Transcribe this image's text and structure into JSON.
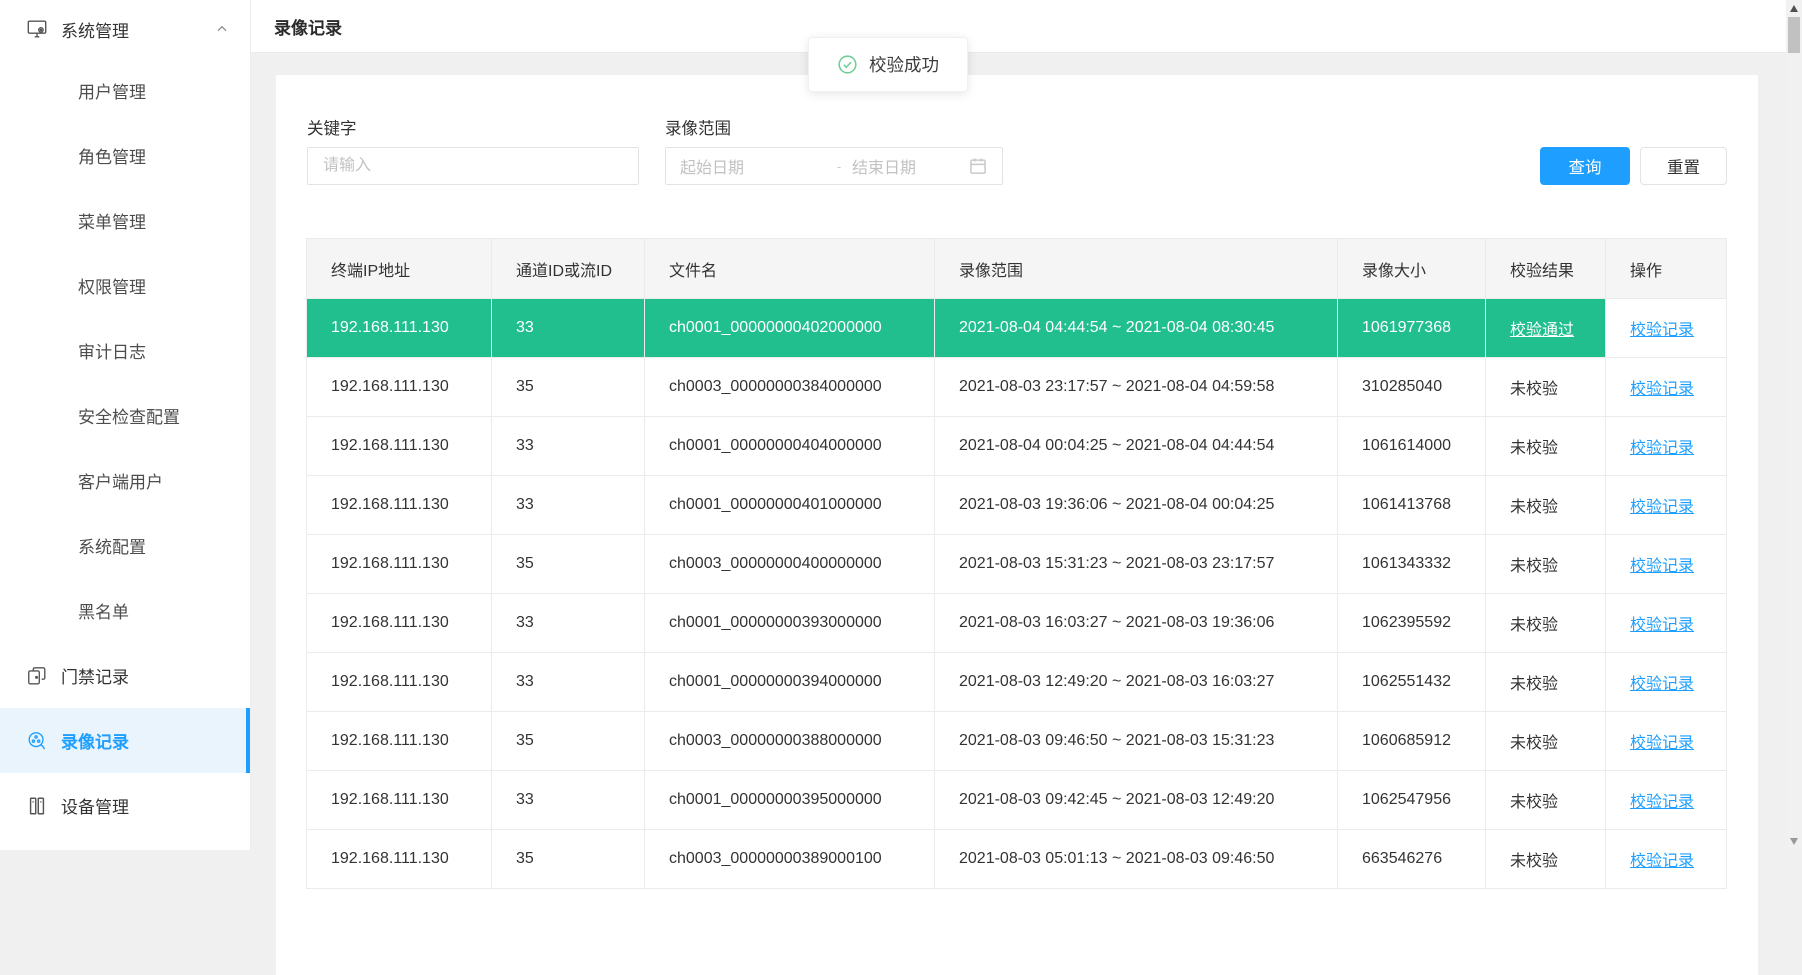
{
  "colors": {
    "accent_blue": "#1e9fff",
    "selected_green": "#21be8e",
    "toast_green": "#6fce97",
    "header_gray": "#f5f5f5"
  },
  "topbar": {
    "title": "录像记录"
  },
  "toast": {
    "text": "校验成功",
    "icon": "success-check-icon"
  },
  "sidebar": {
    "items": [
      {
        "type": "group",
        "name": "system-management",
        "label": "系统管理",
        "icon": "monitor-gear-icon",
        "state": "expanded"
      },
      {
        "type": "sub",
        "name": "user-management",
        "label": "用户管理"
      },
      {
        "type": "sub",
        "name": "role-management",
        "label": "角色管理"
      },
      {
        "type": "sub",
        "name": "menu-management",
        "label": "菜单管理"
      },
      {
        "type": "sub",
        "name": "permission-management",
        "label": "权限管理"
      },
      {
        "type": "sub",
        "name": "audit-log",
        "label": "审计日志"
      },
      {
        "type": "sub",
        "name": "security-check-config",
        "label": "安全检查配置"
      },
      {
        "type": "sub",
        "name": "client-user",
        "label": "客户端用户"
      },
      {
        "type": "sub",
        "name": "system-config",
        "label": "系统配置"
      },
      {
        "type": "sub",
        "name": "blacklist",
        "label": "黑名单"
      },
      {
        "type": "top",
        "name": "access-records",
        "label": "门禁记录",
        "icon": "door-access-icon"
      },
      {
        "type": "top",
        "name": "video-records",
        "label": "录像记录",
        "icon": "film-reel-icon",
        "active": true
      },
      {
        "type": "top",
        "name": "device-management",
        "label": "设备管理",
        "icon": "device-rack-icon"
      }
    ]
  },
  "filters": {
    "keyword_label": "关键字",
    "keyword_placeholder": "请输入",
    "range_label": "录像范围",
    "range_start_placeholder": "起始日期",
    "range_separator": "-",
    "range_end_placeholder": "结束日期",
    "search_label": "查询",
    "reset_label": "重置"
  },
  "table": {
    "columns": [
      "终端IP地址",
      "通道ID或流ID",
      "文件名",
      "录像范围",
      "录像大小",
      "校验结果",
      "操作"
    ],
    "action_label": "校验记录",
    "rows": [
      {
        "ip": "192.168.111.130",
        "channel": "33",
        "file": "ch0001_00000000402000000",
        "range": "2021-08-04 04:44:54 ~ 2021-08-04 08:30:45",
        "size": "1061977368",
        "result": "校验通过",
        "selected": true
      },
      {
        "ip": "192.168.111.130",
        "channel": "35",
        "file": "ch0003_00000000384000000",
        "range": "2021-08-03 23:17:57 ~ 2021-08-04 04:59:58",
        "size": "310285040",
        "result": "未校验",
        "selected": false
      },
      {
        "ip": "192.168.111.130",
        "channel": "33",
        "file": "ch0001_00000000404000000",
        "range": "2021-08-04 00:04:25 ~ 2021-08-04 04:44:54",
        "size": "1061614000",
        "result": "未校验",
        "selected": false
      },
      {
        "ip": "192.168.111.130",
        "channel": "33",
        "file": "ch0001_00000000401000000",
        "range": "2021-08-03 19:36:06 ~ 2021-08-04 00:04:25",
        "size": "1061413768",
        "result": "未校验",
        "selected": false
      },
      {
        "ip": "192.168.111.130",
        "channel": "35",
        "file": "ch0003_00000000400000000",
        "range": "2021-08-03 15:31:23 ~ 2021-08-03 23:17:57",
        "size": "1061343332",
        "result": "未校验",
        "selected": false
      },
      {
        "ip": "192.168.111.130",
        "channel": "33",
        "file": "ch0001_00000000393000000",
        "range": "2021-08-03 16:03:27 ~ 2021-08-03 19:36:06",
        "size": "1062395592",
        "result": "未校验",
        "selected": false
      },
      {
        "ip": "192.168.111.130",
        "channel": "33",
        "file": "ch0001_00000000394000000",
        "range": "2021-08-03 12:49:20 ~ 2021-08-03 16:03:27",
        "size": "1062551432",
        "result": "未校验",
        "selected": false
      },
      {
        "ip": "192.168.111.130",
        "channel": "35",
        "file": "ch0003_00000000388000000",
        "range": "2021-08-03 09:46:50 ~ 2021-08-03 15:31:23",
        "size": "1060685912",
        "result": "未校验",
        "selected": false
      },
      {
        "ip": "192.168.111.130",
        "channel": "33",
        "file": "ch0001_00000000395000000",
        "range": "2021-08-03 09:42:45 ~ 2021-08-03 12:49:20",
        "size": "1062547956",
        "result": "未校验",
        "selected": false
      },
      {
        "ip": "192.168.111.130",
        "channel": "35",
        "file": "ch0003_00000000389000100",
        "range": "2021-08-03 05:01:13 ~ 2021-08-03 09:46:50",
        "size": "663546276",
        "result": "未校验",
        "selected": false
      }
    ]
  },
  "scrollbar": {
    "thumb_position": "top"
  }
}
